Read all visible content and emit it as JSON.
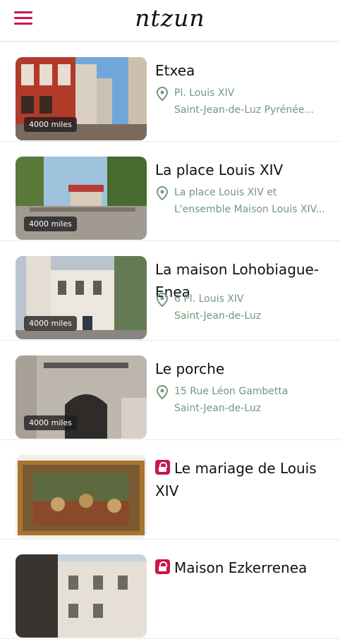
{
  "app": {
    "logo_text": "ntzun"
  },
  "colors": {
    "accent": "#c8174a",
    "address_green": "#74977a",
    "divider": "#e9e9e9"
  },
  "icons": {
    "menu": "hamburger-menu-icon",
    "location": "map-pin-icon",
    "locked": "lock-icon"
  },
  "places": [
    {
      "title": "Etxea",
      "address_line1": "Pl. Louis XIV",
      "address_line2": "Saint-Jean-de-Luz Pyrénée...",
      "distance": "4000 miles",
      "locked": false
    },
    {
      "title": "La place Louis XIV",
      "address_line1": "La place Louis XIV et",
      "address_line2": "L'ensemble Maison Louis XIV...",
      "distance": "4000 miles",
      "locked": false
    },
    {
      "title": "La maison Lohobiague-Enea",
      "address_line1": "6 Pl. Louis XIV",
      "address_line2": "Saint-Jean-de-Luz",
      "distance": "4000 miles",
      "locked": false
    },
    {
      "title": "Le porche",
      "address_line1": "15 Rue Léon Gambetta",
      "address_line2": "Saint-Jean-de-Luz",
      "distance": "4000 miles",
      "locked": false
    },
    {
      "title": "Le mariage de Louis XIV",
      "locked": true
    },
    {
      "title": "Maison Ezkerrenea",
      "locked": true
    }
  ]
}
